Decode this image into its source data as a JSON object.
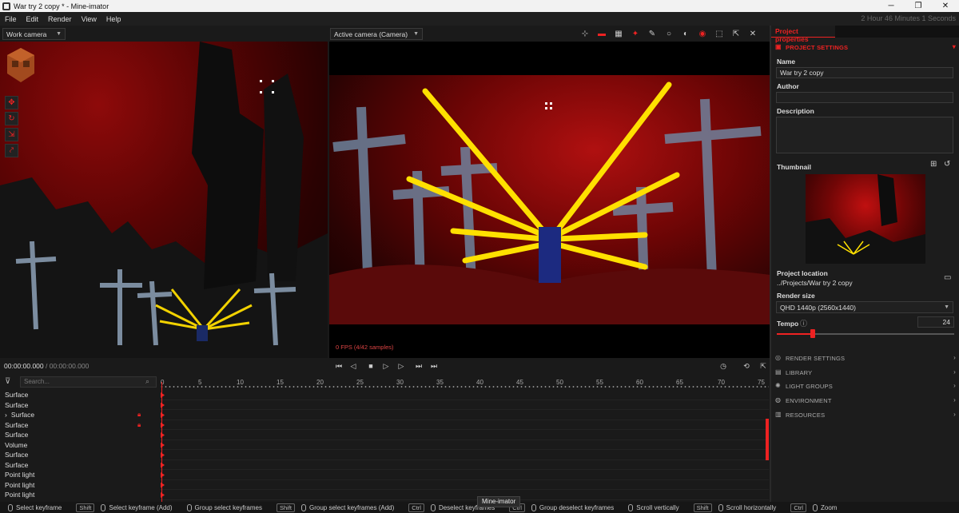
{
  "window": {
    "title": "War try 2 copy *  - Mine-imator",
    "minimize": "─",
    "maximize": "❐",
    "close": "✕"
  },
  "menu": {
    "items": [
      "File",
      "Edit",
      "Render",
      "View",
      "Help"
    ],
    "session_time": "2 Hour 46 Minutes 1 Seconds"
  },
  "viewport_left": {
    "camera": "Work camera"
  },
  "viewport_right": {
    "camera": "Active camera (Camera)",
    "fps": "0 FPS (4/42 samples)"
  },
  "timeline": {
    "time_current": "00:00:00.000",
    "time_total": "/ 00:00:00.000",
    "search_placeholder": "Search...",
    "ruler": [
      "0",
      "5",
      "10",
      "15",
      "20",
      "25",
      "30",
      "35",
      "40",
      "45",
      "50",
      "55",
      "60",
      "65",
      "70",
      "75"
    ],
    "items": [
      {
        "label": "Surface",
        "expand": "",
        "locked": false
      },
      {
        "label": "Surface",
        "expand": "",
        "locked": false
      },
      {
        "label": "Surface",
        "expand": "›",
        "locked": true
      },
      {
        "label": "Surface",
        "expand": "",
        "locked": true
      },
      {
        "label": "Surface",
        "expand": "",
        "locked": false
      },
      {
        "label": "Volume",
        "expand": "",
        "locked": false
      },
      {
        "label": "Surface",
        "expand": "",
        "locked": false
      },
      {
        "label": "Surface",
        "expand": "",
        "locked": false
      },
      {
        "label": "Point light",
        "expand": "",
        "locked": false
      },
      {
        "label": "Point light",
        "expand": "",
        "locked": false
      },
      {
        "label": "Point light",
        "expand": "",
        "locked": false
      }
    ]
  },
  "panel": {
    "tab": "Project properties",
    "section": "PROJECT SETTINGS",
    "name_label": "Name",
    "name_value": "War try 2 copy",
    "author_label": "Author",
    "author_value": "",
    "description_label": "Description",
    "thumbnail_label": "Thumbnail",
    "location_label": "Project location",
    "location_value": "../Projects/War try 2 copy",
    "render_size_label": "Render size",
    "render_size_value": "QHD 1440p (2560x1440)",
    "tempo_label": "Tempo",
    "tempo_value": "24",
    "collapsed_sections": [
      "RENDER SETTINGS",
      "LIBRARY",
      "LIGHT GROUPS",
      "ENVIRONMENT",
      "RESOURCES"
    ]
  },
  "status": {
    "hints": [
      {
        "key": "",
        "mouse": true,
        "text": "Select keyframe"
      },
      {
        "key": "Shift",
        "mouse": true,
        "text": "Select keyframe (Add)"
      },
      {
        "key": "",
        "mouse": true,
        "text": "Group select keyframes"
      },
      {
        "key": "Shift",
        "mouse": true,
        "text": "Group select keyframes (Add)"
      },
      {
        "key": "Ctrl",
        "mouse": true,
        "text": "Deselect keyframes"
      },
      {
        "key": "Ctrl",
        "mouse": true,
        "text": "Group deselect keyframes"
      },
      {
        "key": "",
        "mouse": true,
        "text": "Scroll vertically"
      },
      {
        "key": "Shift",
        "mouse": true,
        "text": "Scroll horizontally"
      },
      {
        "key": "Ctrl",
        "mouse": true,
        "text": "Zoom"
      }
    ],
    "tooltip": "Mine-imator"
  },
  "colors": {
    "accent": "#e22222",
    "background": "#1a1a1a"
  }
}
